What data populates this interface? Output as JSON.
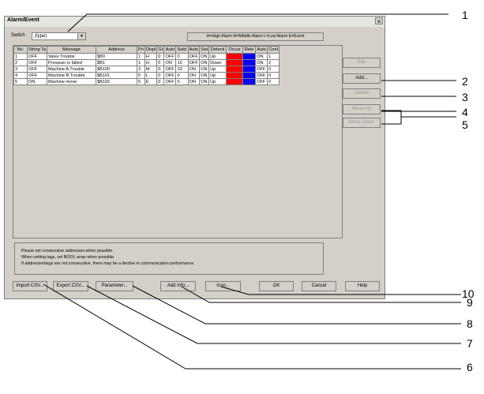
{
  "window": {
    "title": "Alarm/Event",
    "close_glyph": "×"
  },
  "switch": {
    "label": "Switch",
    "value": "(type)"
  },
  "legend_text": "H=High Alarm M=Middle Alarm L=Low Alarm E=Event",
  "table": {
    "headers": [
      "No.",
      "String Ta",
      "Message",
      "Address",
      "Pri",
      "Displ",
      "Gr",
      "Auto",
      "Swtc",
      "Auto",
      "Swi",
      "Detecti",
      "Occur",
      "Rele",
      "Auto",
      "Cont"
    ],
    "rows": [
      {
        "cells": [
          "1",
          "OFF",
          "Valve Trouble",
          "$B0",
          "1",
          "H",
          "0",
          "OFF",
          "0",
          "OFF",
          "ON",
          "Up",
          "",
          "",
          "ON",
          "1"
        ]
      },
      {
        "cells": [
          "2",
          "OFF",
          "Pressuer is failed",
          "$B1",
          "1",
          "H",
          "0",
          "ON",
          "10",
          "OFF",
          "ON",
          "Down",
          "",
          "",
          "ON",
          "2"
        ]
      },
      {
        "cells": [
          "3",
          "OFF",
          "Machine A Trouble",
          "$B100",
          "3",
          "M",
          "0",
          "OFF",
          "10",
          "ON",
          "ON",
          "Up",
          "",
          "",
          "OFF",
          "0"
        ]
      },
      {
        "cells": [
          "4",
          "OFF",
          "Machine B Trouble",
          "$B101",
          "5",
          "L",
          "0",
          "OFF",
          "0",
          "ON",
          "ON",
          "Up",
          "",
          "",
          "OFF",
          "0"
        ]
      },
      {
        "cells": [
          "5",
          "ON",
          "Machine move",
          "$B102",
          "5",
          "E",
          "0",
          "OFF",
          "0",
          "ON",
          "ON",
          "Up",
          "",
          "",
          "OFF",
          "0"
        ]
      }
    ],
    "occur_color": "#ff0000",
    "release_color": "#0000ff"
  },
  "side_buttons": {
    "edit": "Edit",
    "add": "Add...",
    "delete": "Delete",
    "move_up": "Move Up",
    "move_down": "Move Down"
  },
  "notes": {
    "line1": "Please set consecutive addresses when possible.",
    "line2": "When setting tags, set BOOL array when possible.",
    "line3": "If addresses/tags are not consecutive, there may be a decline in communication performance."
  },
  "bottom_buttons": {
    "import_csv": "Import CSV...",
    "export_csv": "Export CSV...",
    "parameter": "Parameter...",
    "add_info": "Add Info...",
    "icon": "Icon...",
    "ok": "OK",
    "cancel": "Cancel",
    "help": "Help"
  },
  "callouts": [
    "1",
    "2",
    "3",
    "4",
    "5",
    "6",
    "7",
    "8",
    "9",
    "10"
  ]
}
